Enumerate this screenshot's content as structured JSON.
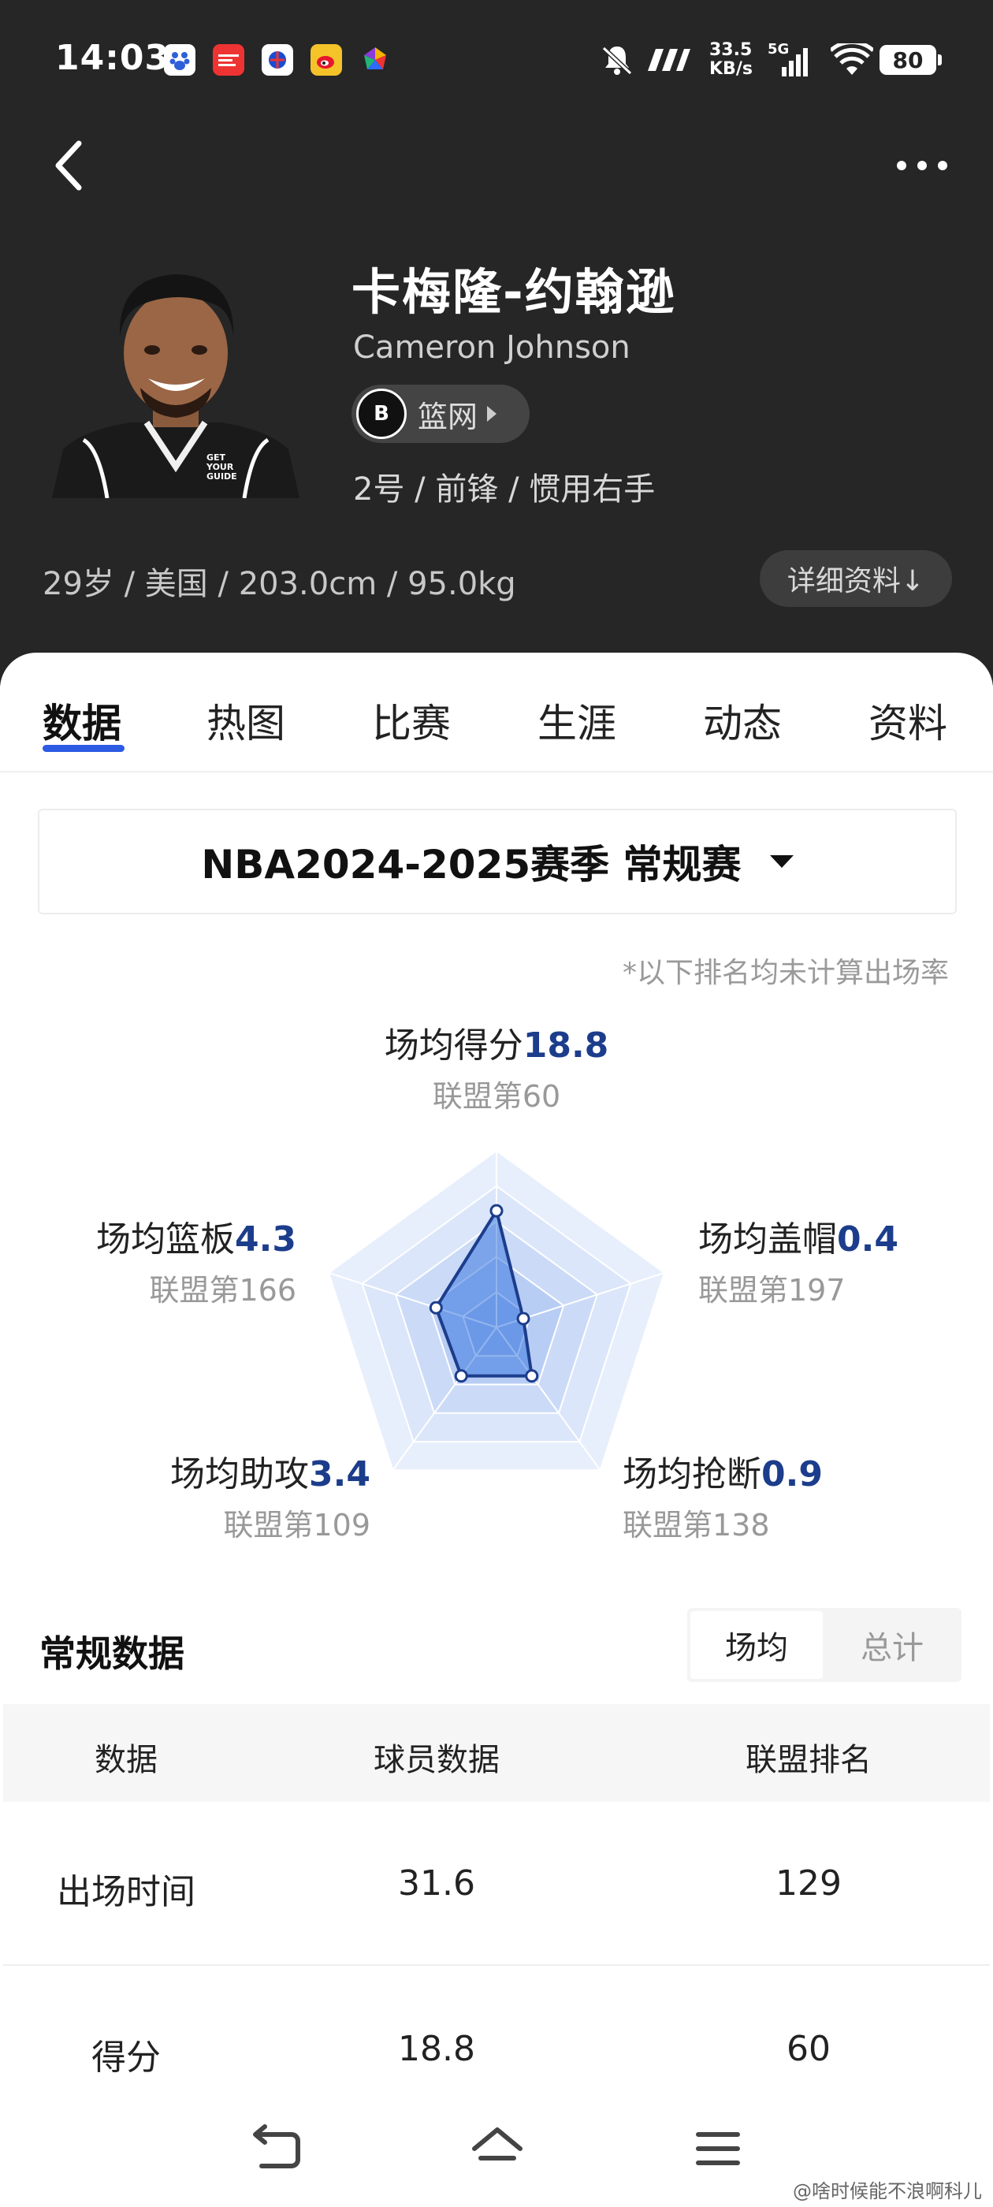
{
  "status_bar": {
    "time": "14:03",
    "net_speed_value": "33.5",
    "net_speed_unit": "KB/s",
    "network": "5G",
    "battery": "80",
    "app_icons": [
      "baidu-icon",
      "toutiao-icon",
      "sports-app-icon",
      "weibo-icon",
      "colorful-app-icon"
    ]
  },
  "header": {
    "player_name_cn": "卡梅隆-约翰逊",
    "player_name_en": "Cameron Johnson",
    "team": "篮网",
    "team_logo_text": "B",
    "position_info": "2号 / 前锋 / 惯用右手",
    "basic_info": "29岁 / 美国 / 203.0cm / 95.0kg",
    "detail_button": "详细资料↓"
  },
  "tabs": [
    {
      "label": "数据",
      "active": true
    },
    {
      "label": "热图",
      "active": false
    },
    {
      "label": "比赛",
      "active": false
    },
    {
      "label": "生涯",
      "active": false
    },
    {
      "label": "动态",
      "active": false
    },
    {
      "label": "资料",
      "active": false
    }
  ],
  "season_selector": "NBA2024-2025赛季 常规赛",
  "ranking_note": "*以下排名均未计算出场率",
  "radar": {
    "points": {
      "label": "场均得分",
      "value": "18.8",
      "rank": "联盟第60"
    },
    "blocks": {
      "label": "场均盖帽",
      "value": "0.4",
      "rank": "联盟第197"
    },
    "steals": {
      "label": "场均抢断",
      "value": "0.9",
      "rank": "联盟第138"
    },
    "assists": {
      "label": "场均助攻",
      "value": "3.4",
      "rank": "联盟第109"
    },
    "rebounds": {
      "label": "场均篮板",
      "value": "4.3",
      "rank": "联盟第166"
    },
    "accent_color": "#1c3d8c",
    "fill_color": "#3a78e0"
  },
  "stats_section": {
    "title": "常规数据",
    "toggle_avg": "场均",
    "toggle_total": "总计",
    "columns": [
      "数据",
      "球员数据",
      "联盟排名"
    ],
    "rows": [
      {
        "name": "出场时间",
        "value": "31.6",
        "rank": "129"
      },
      {
        "name": "得分",
        "value": "18.8",
        "rank": "60"
      }
    ]
  },
  "watermark": "@啥时候能不浪啊科儿"
}
